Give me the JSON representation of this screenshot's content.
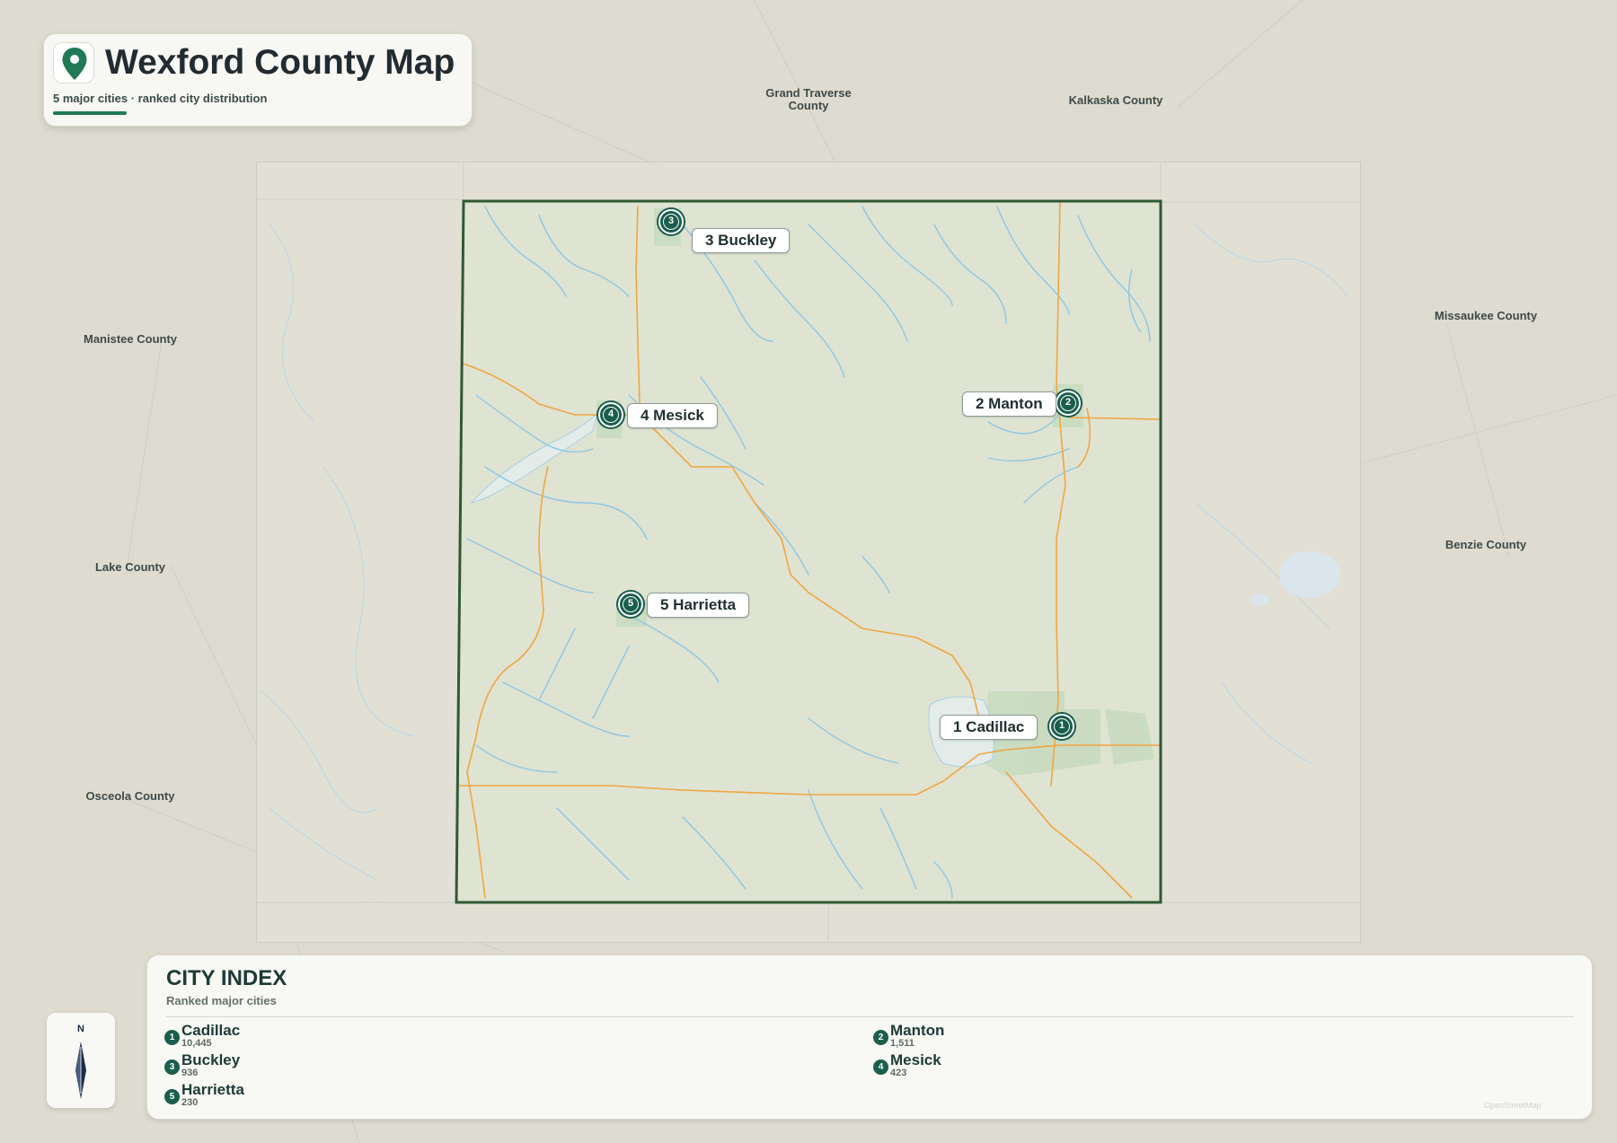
{
  "header": {
    "title": "Wexford County Map",
    "subtitle": "5 major cities · ranked city distribution",
    "pin_icon": "map-pin-icon"
  },
  "neighbors": [
    {
      "key": "grand-traverse",
      "name": "Grand Traverse\nCounty"
    },
    {
      "key": "kalkaska",
      "name": "Kalkaska County"
    },
    {
      "key": "missaukee",
      "name": "Missaukee County"
    },
    {
      "key": "manistee",
      "name": "Manistee County"
    },
    {
      "key": "lake",
      "name": "Lake County"
    },
    {
      "key": "benzie",
      "name": "Benzie County"
    },
    {
      "key": "osceola",
      "name": "Osceola County"
    }
  ],
  "cities": [
    {
      "rank": "1",
      "name": "Cadillac",
      "label": "1 Cadillac",
      "population": "10,445"
    },
    {
      "rank": "2",
      "name": "Manton",
      "label": "2 Manton",
      "population": "1,511"
    },
    {
      "rank": "3",
      "name": "Buckley",
      "label": "3 Buckley",
      "population": "936"
    },
    {
      "rank": "4",
      "name": "Mesick",
      "label": "4 Mesick",
      "population": "423"
    },
    {
      "rank": "5",
      "name": "Harrietta",
      "label": "5 Harrietta",
      "population": "230"
    }
  ],
  "index": {
    "title": "CITY INDEX",
    "subtitle": "Ranked major cities"
  },
  "compass": {
    "label": "N",
    "icon": "north-arrow-icon"
  },
  "attribution": "OpenStreetMap",
  "colors": {
    "background": "#dedbd0",
    "county_fill": "#dfe3d2",
    "county_border": "#2f5a35",
    "roads": "#f0a640",
    "water": "#8ec7e3",
    "urban": "#c8dbc0",
    "marker": "#1a5e4c"
  }
}
